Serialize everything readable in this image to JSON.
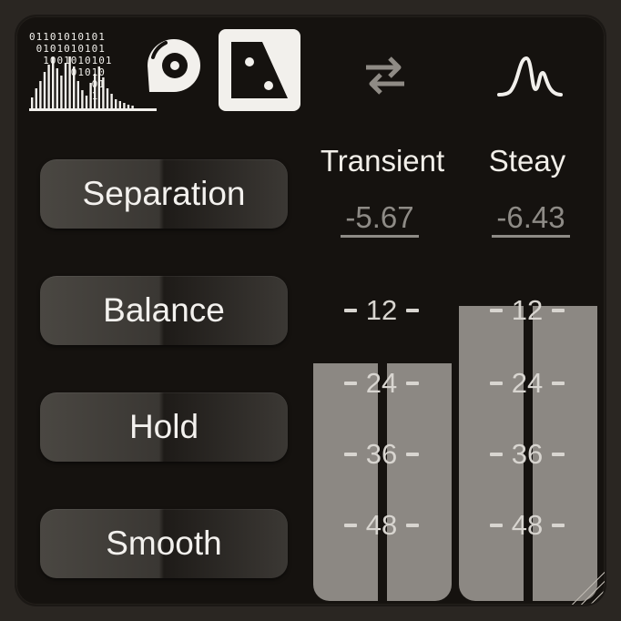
{
  "header": {
    "logo_bits": [
      "01101010101",
      " 0101010101",
      "  1001010101",
      "      01010",
      "         01",
      "         1"
    ],
    "logo_icon": "binary-waveform-logo",
    "disc_icon": "disc-icon",
    "mode_icon": "transient-steady-icon",
    "swap_icon": "swap-arrows-icon",
    "spectrum_icon": "peak-wave-icon"
  },
  "controls": [
    {
      "label": "Separation"
    },
    {
      "label": "Balance"
    },
    {
      "label": "Hold"
    },
    {
      "label": "Smooth"
    }
  ],
  "meters": {
    "transient": {
      "title": "Transient",
      "value": "-5.67",
      "level": 0.63
    },
    "steady": {
      "title": "Steay",
      "value": "-6.43",
      "level": 0.78
    }
  },
  "scale": [
    "12",
    "24",
    "36",
    "48"
  ],
  "colors": {
    "panel": "#15120f",
    "meter": "#8c8883",
    "text": "#f2efe9",
    "muted": "#8e8b86"
  }
}
